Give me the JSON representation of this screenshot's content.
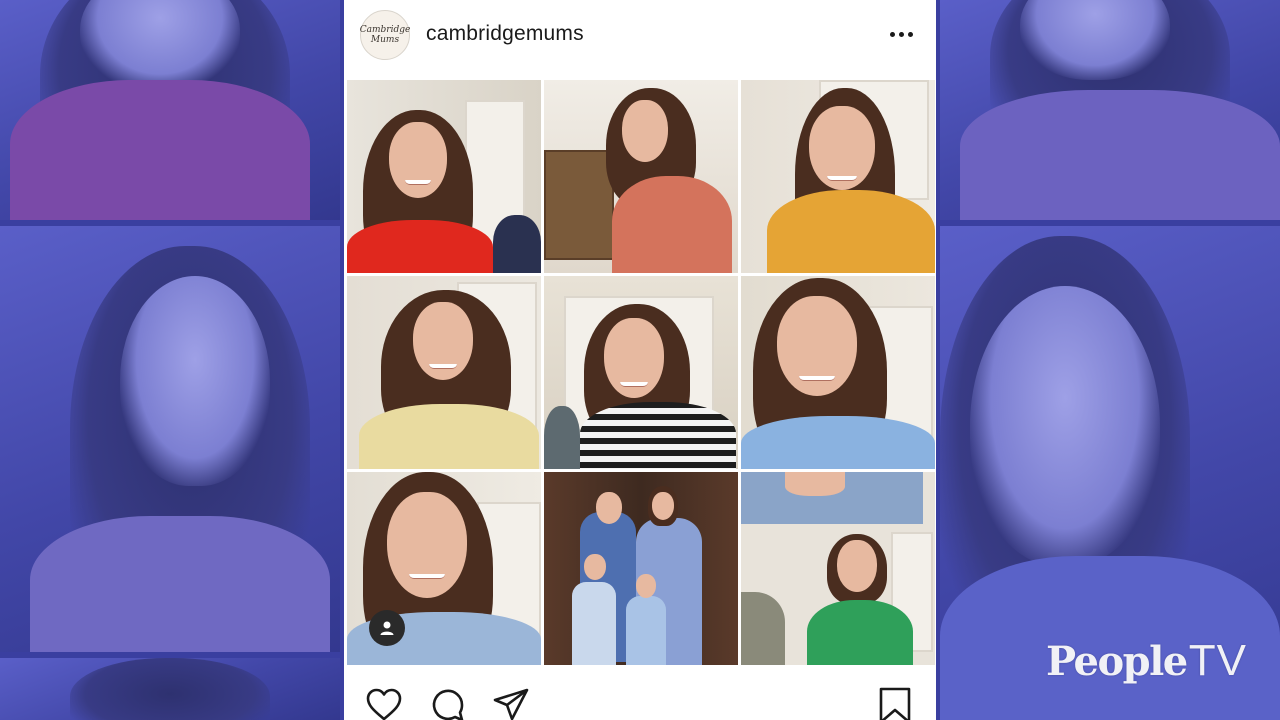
{
  "post": {
    "username": "cambridgemums",
    "avatar_text": "Cambridge Mums",
    "more_icon": "more-horizontal-icon",
    "grid_tiles": [
      {
        "desc": "video-call-tile"
      },
      {
        "desc": "phone-call-tile"
      },
      {
        "desc": "video-call-tile"
      },
      {
        "desc": "video-call-tile"
      },
      {
        "desc": "video-call-tile"
      },
      {
        "desc": "video-call-tile"
      },
      {
        "desc": "video-call-tile"
      },
      {
        "desc": "family-photo-tile"
      },
      {
        "desc": "video-call-tile"
      }
    ],
    "actions": {
      "like_icon": "heart-icon",
      "comment_icon": "comment-icon",
      "share_icon": "paper-plane-icon",
      "save_icon": "bookmark-icon"
    }
  },
  "watermark": {
    "brand": "People",
    "suffix": "TV"
  },
  "colors": {
    "backdrop": "#3a3fa0",
    "post_bg": "#ffffff",
    "text": "#1a1a1a"
  }
}
